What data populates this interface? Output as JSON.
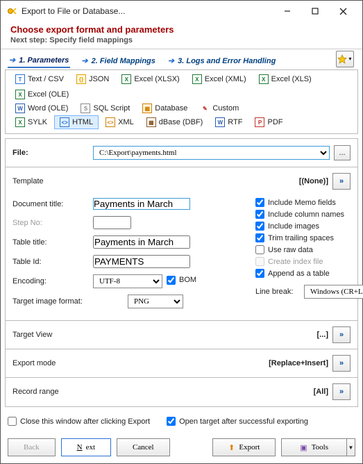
{
  "window": {
    "title": "Export to File or Database..."
  },
  "header": {
    "title": "Choose export format and parameters",
    "subtitle": "Next step: Specify field mappings"
  },
  "tabs": {
    "t1": "1. Parameters",
    "t2": "2. Field Mappings",
    "t3": "3. Logs and Error Handling"
  },
  "formats": {
    "csv": "Text / CSV",
    "json": "JSON",
    "xlsx": "Excel (XLSX)",
    "xlsm": "Excel (XML)",
    "xls": "Excel (XLS)",
    "ole": "Excel (OLE)",
    "word": "Word (OLE)",
    "sql": "SQL Script",
    "db": "Database",
    "custom": "Custom",
    "sylk": "SYLK",
    "html": "HTML",
    "xml": "XML",
    "dbf": "dBase (DBF)",
    "rtf": "RTF",
    "pdf": "PDF"
  },
  "fields": {
    "file_label": "File:",
    "file_value": "C:\\Export\\payments.html",
    "template_label": "Template",
    "template_value": "[(None)]",
    "doctitle_label": "Document title:",
    "doctitle_value": "Payments in March",
    "stepno_label": "Step No:",
    "stepno_value": "",
    "tabletitle_label": "Table title:",
    "tabletitle_value": "Payments in March",
    "tableid_label": "Table Id:",
    "tableid_value": "PAYMENTS",
    "encoding_label": "Encoding:",
    "encoding_value": "UTF-8",
    "bom_label": "BOM",
    "imgfmt_label": "Target image format:",
    "imgfmt_value": "PNG",
    "linebreak_label": "Line break:",
    "linebreak_value": "Windows (CR+LF)"
  },
  "checks": {
    "memo": "Include Memo fields",
    "cols": "Include column names",
    "imgs": "Include images",
    "trim": "Trim trailing spaces",
    "raw": "Use raw data",
    "idx": "Create index file",
    "append": "Append as a table"
  },
  "sections": {
    "target_view_l": "Target View",
    "target_view_v": "[...]",
    "export_mode_l": "Export mode",
    "export_mode_v": "[Replace+Insert]",
    "record_range_l": "Record range",
    "record_range_v": "[All]"
  },
  "footer": {
    "close": "Close this window after clicking Export",
    "open": "Open target after successful exporting",
    "back": "Back",
    "next": "Next",
    "cancel": "Cancel",
    "export": "Export",
    "tools": "Tools"
  }
}
